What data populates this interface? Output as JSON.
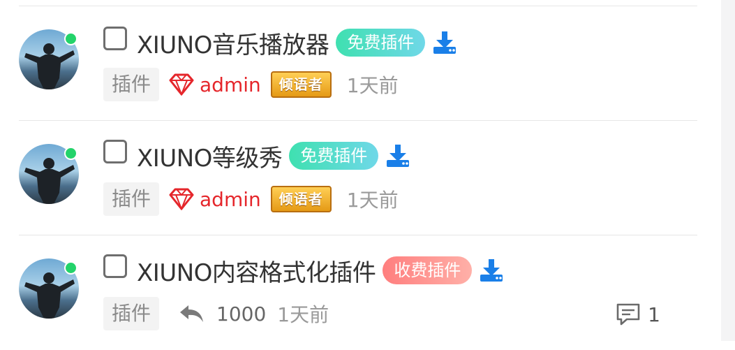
{
  "threads": [
    {
      "title": "XIUNO音乐播放器",
      "price_badge": "免费插件",
      "price_type": "free",
      "tag": "插件",
      "user": "admin",
      "rank": "倾语者",
      "time": "1天前"
    },
    {
      "title": "XIUNO等级秀",
      "price_badge": "免费插件",
      "price_type": "free",
      "tag": "插件",
      "user": "admin",
      "rank": "倾语者",
      "time": "1天前"
    },
    {
      "title": "XIUNO内容格式化插件",
      "price_badge": "收费插件",
      "price_type": "paid",
      "tag": "插件",
      "reply_count": "1000",
      "time": "1天前",
      "comment_count": "1"
    }
  ],
  "colors": {
    "free_badge": "#3fe0b0",
    "paid_badge": "#ff7e7e",
    "username": "#e5262b",
    "download": "#1a7fe8",
    "online": "#23d36a"
  },
  "icons": [
    "download-icon",
    "gem-icon",
    "reply-icon",
    "comment-icon"
  ]
}
